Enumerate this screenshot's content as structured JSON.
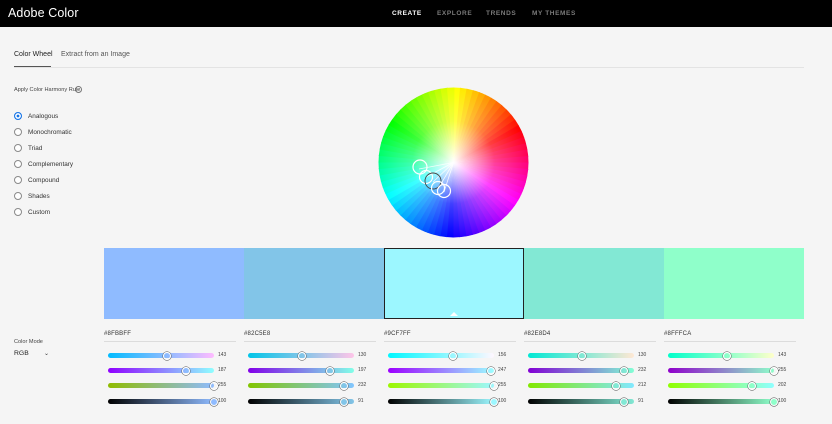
{
  "header": {
    "app_title": "Adobe Color",
    "nav": [
      {
        "label": "CREATE",
        "active": true
      },
      {
        "label": "EXPLORE",
        "active": false
      },
      {
        "label": "TRENDS",
        "active": false
      },
      {
        "label": "MY THEMES",
        "active": false
      }
    ]
  },
  "tabs": [
    {
      "label": "Color Wheel",
      "active": true
    },
    {
      "label": "Extract from an Image",
      "active": false
    }
  ],
  "harmony": {
    "label": "Apply Color Harmony Rule",
    "help_icon": "help-circle-icon",
    "options": [
      {
        "label": "Analogous",
        "selected": true
      },
      {
        "label": "Monochromatic",
        "selected": false
      },
      {
        "label": "Triad",
        "selected": false
      },
      {
        "label": "Complementary",
        "selected": false
      },
      {
        "label": "Compound",
        "selected": false
      },
      {
        "label": "Shades",
        "selected": false
      },
      {
        "label": "Custom",
        "selected": false
      }
    ]
  },
  "color_mode": {
    "label": "Color Mode",
    "value": "RGB",
    "caret_icon": "chevron-down-icon"
  },
  "swatches": [
    {
      "hex": "#8FBBFF",
      "color": "#8fbbff",
      "selected": false,
      "rgb": [
        143,
        187,
        255
      ],
      "brightness": 100
    },
    {
      "hex": "#82C5E8",
      "color": "#82c5e8",
      "selected": false,
      "rgb": [
        130,
        197,
        232
      ],
      "brightness": 91
    },
    {
      "hex": "#9CF7FF",
      "color": "#9cf7ff",
      "selected": true,
      "rgb": [
        156,
        247,
        255
      ],
      "brightness": 100
    },
    {
      "hex": "#82E8D4",
      "color": "#82e8d4",
      "selected": false,
      "rgb": [
        130,
        232,
        212
      ],
      "brightness": 91
    },
    {
      "hex": "#8FFFCA",
      "color": "#8fffca",
      "selected": false,
      "rgb": [
        143,
        255,
        202
      ],
      "brightness": 100
    }
  ]
}
